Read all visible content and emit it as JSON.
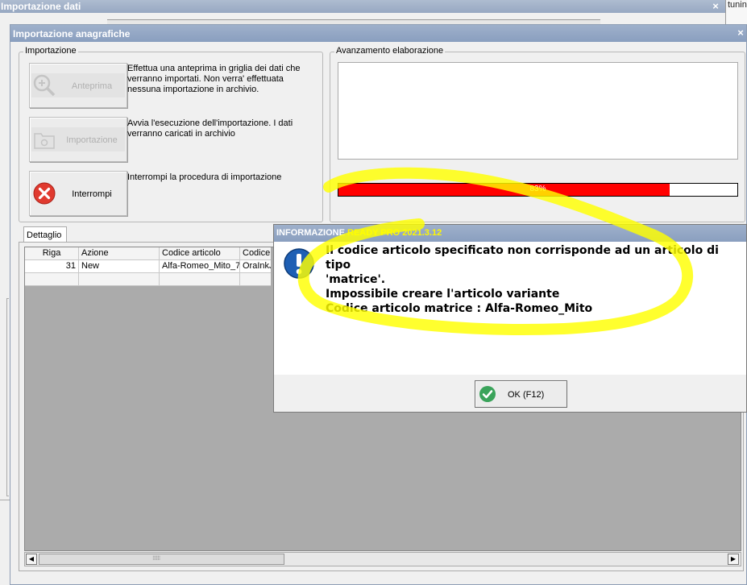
{
  "outer_window": {
    "title": "Importazione dati",
    "close": "×",
    "side_text": "tuning"
  },
  "window": {
    "title": "Importazione anagrafiche",
    "close": "×"
  },
  "import_group": {
    "legend": "Importazione",
    "preview": {
      "label": "Anteprima",
      "desc": "Effettua una anteprima in griglia dei dati che verranno importati. Non verra' effettuata nessuna importazione in archivio."
    },
    "import": {
      "label": "Importazione",
      "desc": "Avvia l'esecuzione dell'importazione. I dati verranno caricati in archivio"
    },
    "stop": {
      "label": "Interrompi",
      "desc": "Interrompi la procedura di importazione"
    }
  },
  "progress_group": {
    "legend": "Avanzamento elaborazione",
    "percent": 83,
    "percent_label": "83%"
  },
  "detail": {
    "tab": "Dettaglio",
    "columns": [
      "Riga",
      "Azione",
      "Codice articolo",
      "Codice p"
    ],
    "rows": [
      {
        "riga": "31",
        "azione": "New",
        "codice_articolo": "Alfa-Romeo_Mito_7",
        "codice_p": "OraInkJe"
      }
    ],
    "scroll_grip": "⁝⁝⁝⁝⁝⁝"
  },
  "dialog": {
    "title_prefix": "INFORMAZIONE ",
    "title_app": "READY PRO 2021.3.12",
    "lines": [
      "Il codice articolo specificato non corrisponde ad un articolo di tipo",
      "'matrice'.",
      "Impossibile creare l'articolo variante",
      "Codice articolo matrice : Alfa-Romeo_Mito"
    ],
    "ok_label": "OK (F12)"
  },
  "colors": {
    "progress_fill": "#ff0000",
    "highlight": "#ffff00",
    "info_icon": "#1e5fb4",
    "ok_icon": "#3aa35a",
    "stop_icon": "#e03a2f"
  },
  "icons": {
    "preview": "magnifier-plus-icon",
    "import": "folder-gear-icon",
    "stop": "close-circle-icon",
    "info": "info-exclamation-icon",
    "ok": "check-circle-icon"
  }
}
